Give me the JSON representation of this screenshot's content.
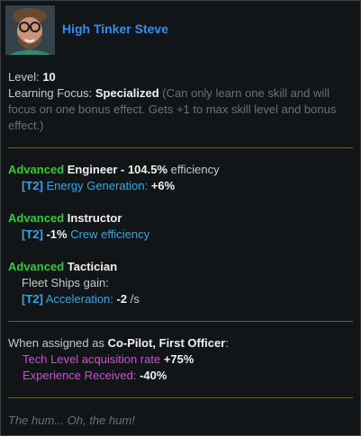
{
  "officer": {
    "name": "High Tinker Steve"
  },
  "stats": {
    "level_label": "Level:",
    "level_value": "10",
    "focus_label": "Learning Focus:",
    "focus_value": "Specialized",
    "focus_note": "(Can only learn one skill and will focus on one bonus effect. Gets +1 to max skill level and bonus effect.)"
  },
  "skills": [
    {
      "tier": "Advanced",
      "name": "Engineer",
      "suffix": " - ",
      "value": "104.5%",
      "value_suffix": " efficiency",
      "tag": "[T2]",
      "effect_pre": "",
      "effect_text": "Energy Generation:",
      "effect_value": "+6%"
    },
    {
      "tier": "Advanced",
      "name": "Instructor",
      "tag": "[T2]",
      "effect_value": "-1%",
      "effect_text": "Crew efficiency"
    },
    {
      "tier": "Advanced",
      "name": "Tactician",
      "subline": "Fleet Ships gain:",
      "tag": "[T2]",
      "effect_text": "Acceleration:",
      "effect_value": "-2",
      "effect_unit": " /s"
    }
  ],
  "assignment": {
    "intro": "When assigned as",
    "roles": "Co-Pilot, First Officer",
    "colon": ":",
    "bonus1_text": "Tech Level acquisition rate",
    "bonus1_value": "+75%",
    "bonus2_text": "Experience Received:",
    "bonus2_value": "-40%"
  },
  "flavor": "The hum... Oh, the hum!",
  "colors": {
    "name": "#2e8ef0",
    "tier": "#35c83b",
    "effect": "#33a6e0",
    "assignment": "#d24ad6",
    "separator": "#6b5f3a"
  }
}
